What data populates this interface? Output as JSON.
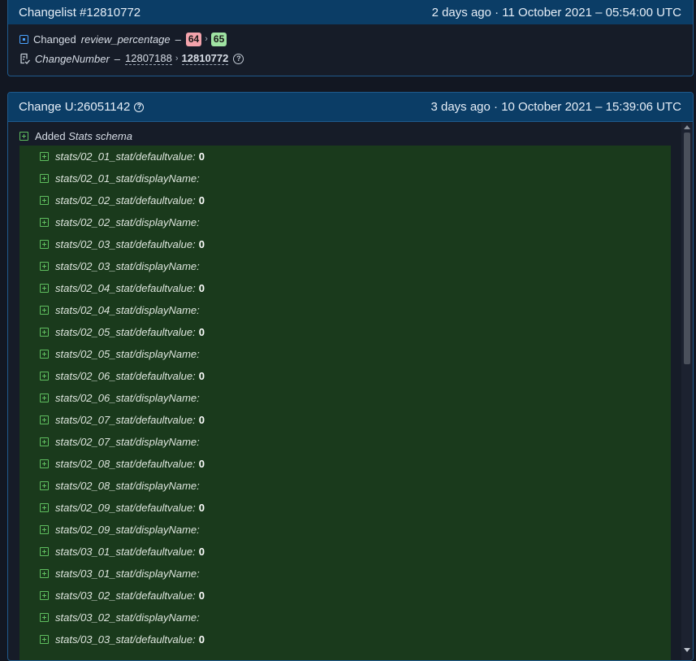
{
  "changelist": {
    "title": "Changelist #12810772",
    "timestamp": "2 days ago · 11 October 2021 – 05:54:00 UTC",
    "changed_label": "Changed",
    "field_name": "review_percentage",
    "dash": "–",
    "old_value": "64",
    "arrow": "›",
    "new_value": "65",
    "change_number_label": "ChangeNumber",
    "old_change": "12807188",
    "new_change": "12810772"
  },
  "change": {
    "title": "Change U:26051142",
    "timestamp": "3 days ago · 10 October 2021 – 15:39:06 UTC",
    "added_label": "Added",
    "added_name": "Stats schema",
    "items": [
      {
        "key": "stats/02_01_stat/defaultvalue:",
        "value": "0"
      },
      {
        "key": "stats/02_01_stat/displayName:",
        "value": ""
      },
      {
        "key": "stats/02_02_stat/defaultvalue:",
        "value": "0"
      },
      {
        "key": "stats/02_02_stat/displayName:",
        "value": ""
      },
      {
        "key": "stats/02_03_stat/defaultvalue:",
        "value": "0"
      },
      {
        "key": "stats/02_03_stat/displayName:",
        "value": ""
      },
      {
        "key": "stats/02_04_stat/defaultvalue:",
        "value": "0"
      },
      {
        "key": "stats/02_04_stat/displayName:",
        "value": ""
      },
      {
        "key": "stats/02_05_stat/defaultvalue:",
        "value": "0"
      },
      {
        "key": "stats/02_05_stat/displayName:",
        "value": ""
      },
      {
        "key": "stats/02_06_stat/defaultvalue:",
        "value": "0"
      },
      {
        "key": "stats/02_06_stat/displayName:",
        "value": ""
      },
      {
        "key": "stats/02_07_stat/defaultvalue:",
        "value": "0"
      },
      {
        "key": "stats/02_07_stat/displayName:",
        "value": ""
      },
      {
        "key": "stats/02_08_stat/defaultvalue:",
        "value": "0"
      },
      {
        "key": "stats/02_08_stat/displayName:",
        "value": ""
      },
      {
        "key": "stats/02_09_stat/defaultvalue:",
        "value": "0"
      },
      {
        "key": "stats/02_09_stat/displayName:",
        "value": ""
      },
      {
        "key": "stats/03_01_stat/defaultvalue:",
        "value": "0"
      },
      {
        "key": "stats/03_01_stat/displayName:",
        "value": ""
      },
      {
        "key": "stats/03_02_stat/defaultvalue:",
        "value": "0"
      },
      {
        "key": "stats/03_02_stat/displayName:",
        "value": ""
      },
      {
        "key": "stats/03_03_stat/defaultvalue:",
        "value": "0"
      }
    ]
  }
}
